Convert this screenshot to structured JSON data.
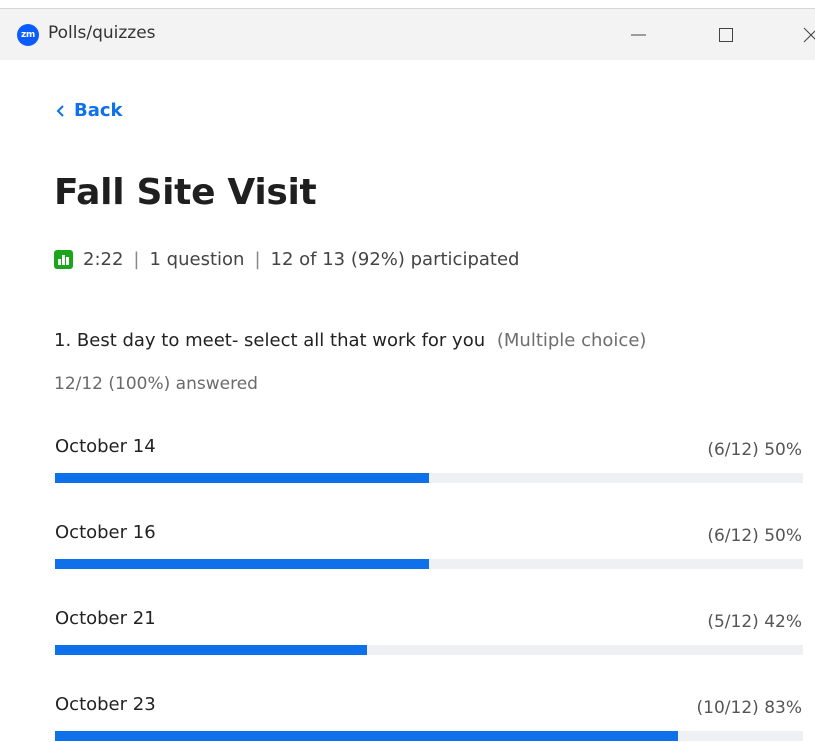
{
  "window": {
    "logo_text": "zm",
    "title": "Polls/quizzes"
  },
  "nav": {
    "back_label": "Back"
  },
  "poll": {
    "title": "Fall Site Visit",
    "duration": "2:22",
    "question_count": "1 question",
    "participation": "12 of 13 (92%) participated"
  },
  "question": {
    "text": "1. Best day to meet- select all that work for you",
    "type": "(Multiple choice)",
    "answered": "12/12 (100%) answered",
    "options": [
      {
        "label": "October 14",
        "stat": "(6/12) 50%",
        "fraction": 0.5
      },
      {
        "label": "October 16",
        "stat": "(6/12) 50%",
        "fraction": 0.5
      },
      {
        "label": "October 21",
        "stat": "(5/12) 42%",
        "fraction": 0.4167
      },
      {
        "label": "October 23",
        "stat": "(10/12) 83%",
        "fraction": 0.8333
      }
    ]
  },
  "colors": {
    "accent": "#0e71eb",
    "poll_icon": "#1aa51a",
    "track": "#eef0f4"
  }
}
